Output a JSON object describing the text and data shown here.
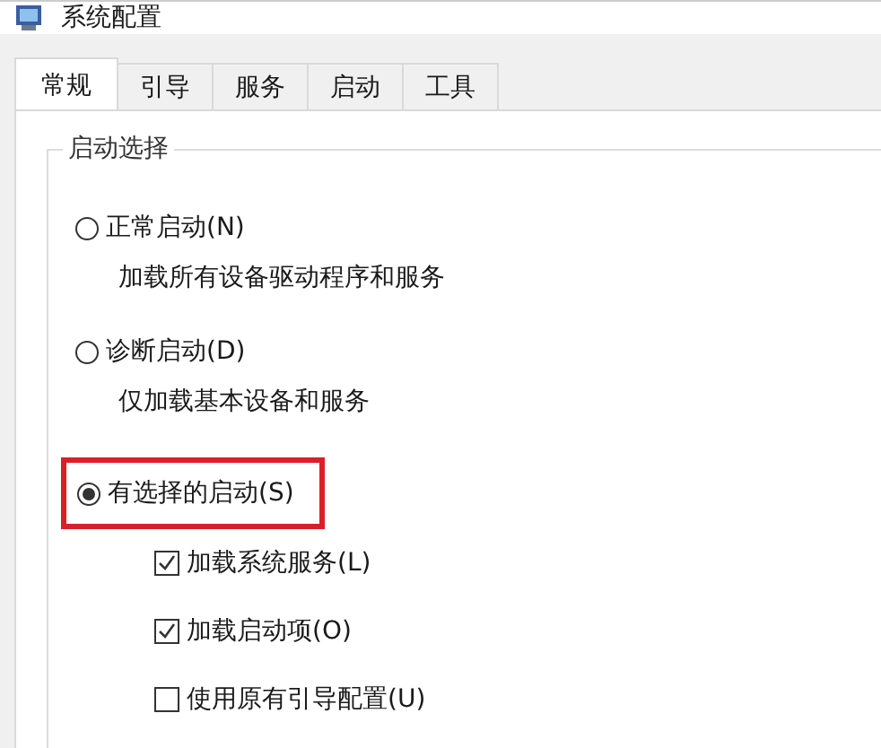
{
  "window": {
    "title": "系统配置"
  },
  "tabs": [
    {
      "label": "常规",
      "selected": true
    },
    {
      "label": "引导",
      "selected": false
    },
    {
      "label": "服务",
      "selected": false
    },
    {
      "label": "启动",
      "selected": false
    },
    {
      "label": "工具",
      "selected": false
    }
  ],
  "startup_group": {
    "title": "启动选择",
    "options": [
      {
        "label": "正常启动(N)",
        "selected": false,
        "highlighted": false,
        "description": "加载所有设备驱动程序和服务"
      },
      {
        "label": "诊断启动(D)",
        "selected": false,
        "highlighted": false,
        "description": "仅加载基本设备和服务"
      },
      {
        "label": "有选择的启动(S)",
        "selected": true,
        "highlighted": true
      }
    ],
    "checkboxes": [
      {
        "label": "加载系统服务(L)",
        "checked": true
      },
      {
        "label": "加载启动项(O)",
        "checked": true
      },
      {
        "label": "使用原有引导配置(U)",
        "checked": false
      }
    ]
  }
}
